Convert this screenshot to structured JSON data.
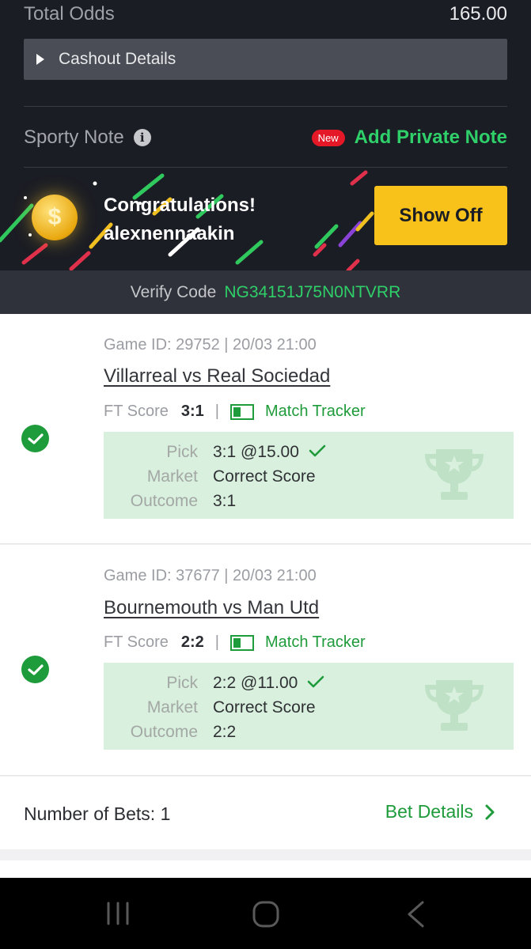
{
  "summary": {
    "total_odds_label": "Total Odds",
    "total_odds_value": "165.00",
    "cashout_label": "Cashout Details"
  },
  "note": {
    "label": "Sporty Note",
    "new_badge": "New",
    "add_label": "Add Private Note"
  },
  "congrats": {
    "line1": "Congratulations!",
    "username": "alexnennaakin",
    "coin_symbol": "$",
    "show_off_label": "Show Off"
  },
  "verify": {
    "label": "Verify Code",
    "code": "NG34151J75N0NTVRR"
  },
  "bets": [
    {
      "game_id": "Game ID: 29752 | 20/03 21:00",
      "match": "Villarreal vs Real Sociedad",
      "ft_label": "FT Score",
      "ft_score": "3:1",
      "tracker_label": "Match Tracker",
      "pick_label": "Pick",
      "pick_value": "3:1 @15.00",
      "market_label": "Market",
      "market_value": "Correct Score",
      "outcome_label": "Outcome",
      "outcome_value": "3:1",
      "status": "won"
    },
    {
      "game_id": "Game ID: 37677 | 20/03 21:00",
      "match": "Bournemouth vs Man Utd",
      "ft_label": "FT Score",
      "ft_score": "2:2",
      "tracker_label": "Match Tracker",
      "pick_label": "Pick",
      "pick_value": "2:2 @11.00",
      "market_label": "Market",
      "market_value": "Correct Score",
      "outcome_label": "Outcome",
      "outcome_value": "2:2",
      "status": "won"
    }
  ],
  "footer": {
    "number_of_bets": "Number of Bets: 1",
    "bet_details_label": "Bet Details"
  },
  "colors": {
    "accent_green": "#1e9b3a",
    "bright_green": "#2fd06a",
    "show_off_yellow": "#f9c21a",
    "new_badge_red": "#e41827",
    "pick_box_bg": "#d9f0de"
  },
  "icons": {
    "cashout": "caret-right-icon",
    "info": "info-icon",
    "coin": "coin-icon",
    "check": "check-circle-icon",
    "tracker": "match-tracker-icon",
    "tick": "checkmark-icon",
    "trophy": "trophy-icon",
    "chevron": "chevron-right-icon",
    "nav": [
      "recent-apps-icon",
      "home-icon",
      "back-icon"
    ]
  }
}
